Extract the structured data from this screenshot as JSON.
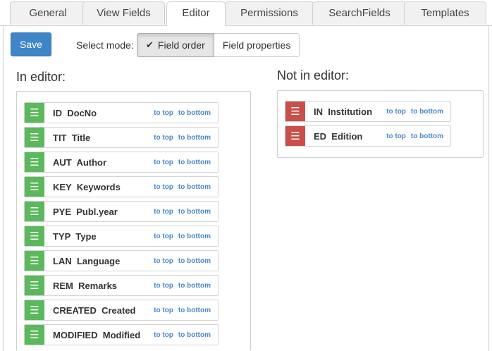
{
  "tabs": [
    {
      "label": "General"
    },
    {
      "label": "View Fields"
    },
    {
      "label": "Editor"
    },
    {
      "label": "Permissions"
    },
    {
      "label": "SearchFields"
    },
    {
      "label": "Templates"
    }
  ],
  "toolbar": {
    "save_label": "Save",
    "mode_label": "Select mode:",
    "mode_options": [
      "Field order",
      "Field properties"
    ],
    "selected_mode": "Field order"
  },
  "in_editor": {
    "title": "In editor:",
    "fields": [
      {
        "label": "ID  DocNo"
      },
      {
        "label": "TIT  Title"
      },
      {
        "label": "AUT  Author"
      },
      {
        "label": "KEY  Keywords"
      },
      {
        "label": "PYE  Publ.year"
      },
      {
        "label": "TYP  Type"
      },
      {
        "label": "LAN  Language"
      },
      {
        "label": "REM  Remarks"
      },
      {
        "label": "CREATED  Created"
      },
      {
        "label": "MODIFIED  Modified"
      }
    ]
  },
  "not_in_editor": {
    "title": "Not in editor:",
    "fields": [
      {
        "label": "IN  Institution"
      },
      {
        "label": "ED  Edition"
      }
    ]
  },
  "links": {
    "to_top": "to top",
    "to_bottom": "to bottom"
  },
  "colors": {
    "in_editor_handle": "#5cb85c",
    "not_in_editor_handle": "#c9504a",
    "primary": "#3f86c7"
  },
  "icons": {
    "handle": "hamburger-icon",
    "selected": "check-icon"
  }
}
